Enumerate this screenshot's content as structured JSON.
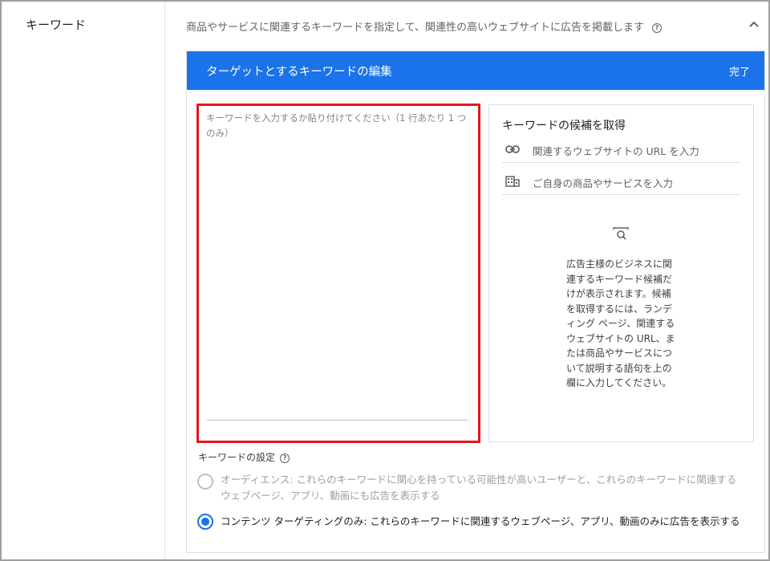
{
  "section": {
    "label": "キーワード",
    "description": "商品やサービスに関連するキーワードを指定して、関連性の高いウェブサイトに広告を掲載します",
    "help_icon": "help-circle-icon",
    "collapse_icon": "chevron-up-icon"
  },
  "editor": {
    "title": "ターゲットとするキーワードの編集",
    "done_label": "完了",
    "header_color": "#1a73e8",
    "keyword_input": {
      "value": "",
      "placeholder": "キーワードを入力するか貼り付けてください（1 行あたり 1 つのみ）"
    },
    "highlight_color": "#e8141c"
  },
  "suggestions": {
    "title": "キーワードの候補を取得",
    "url_row": {
      "icon": "link-icon",
      "label": "関連するウェブサイトの URL を入力"
    },
    "product_row": {
      "icon": "building-icon",
      "label": "ご自身の商品やサービスを入力"
    },
    "illustration_icon": "search-document-icon",
    "info_lines": [
      "広告主様のビジネスに関",
      "連するキーワード候補だ",
      "けが表示されます。候補",
      "を取得するには、ランデ",
      "ィング ページ、関連する",
      "ウェブサイトの URL、ま",
      "たは商品やサービスにつ",
      "いて説明する語句を上の",
      "欄に入力してください。"
    ]
  },
  "settings": {
    "label": "キーワードの設定",
    "help_icon": "help-circle-icon",
    "options": [
      {
        "selected": false,
        "title": "オーディエンス:",
        "line1": " これらのキーワードに関心を持っている可能性が高いユーザーと、これらのキーワードに関連する",
        "line2": "ウェブページ、アプリ、動画にも広告を表示する"
      },
      {
        "selected": true,
        "title": "コンテンツ ターゲティングのみ:",
        "line1": " これらのキーワードに関連するウェブページ、アプリ、動画のみに広告を表示する"
      }
    ]
  }
}
